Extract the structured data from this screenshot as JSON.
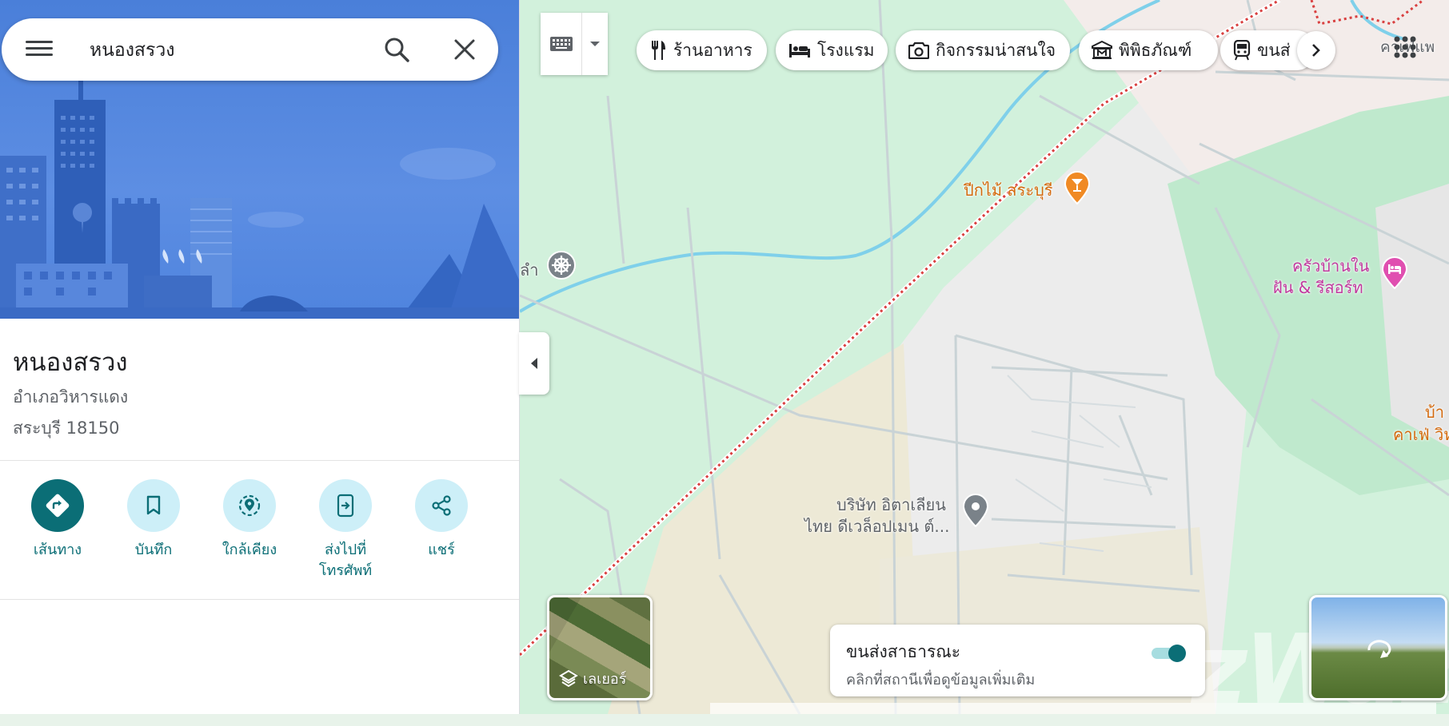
{
  "search": {
    "value": "หนองสรวง"
  },
  "place": {
    "title": "หนองสรวง",
    "address_line1": "อำเภอวิหารแดง",
    "address_line2": "สระบุรี 18150"
  },
  "actions": [
    {
      "label": "เส้นทาง",
      "icon": "directions-icon"
    },
    {
      "label": "บันทึก",
      "icon": "bookmark-icon"
    },
    {
      "label": "ใกล้เคียง",
      "icon": "nearby-icon"
    },
    {
      "label": "ส่งไปที่โทรศัพท์",
      "line1": "ส่งไปที่",
      "line2": "โทรศัพท์",
      "icon": "send-to-phone-icon"
    },
    {
      "label": "แชร์",
      "icon": "share-icon"
    }
  ],
  "chips": [
    {
      "label": "ร้านอาหาร",
      "icon": "restaurant-icon"
    },
    {
      "label": "โรงแรม",
      "icon": "hotel-icon"
    },
    {
      "label": "กิจกรรมน่าสนใจ",
      "icon": "camera-icon"
    },
    {
      "label": "พิพิธภัณฑ์",
      "icon": "museum-icon"
    },
    {
      "label": "ขนส่",
      "icon": "transit-icon"
    }
  ],
  "map_labels": {
    "bar": "ปีกไม้ สระบุรี",
    "resort_line1": "ครัวบ้านใน",
    "resort_line2": "ฝัน & รีสอร์ท",
    "company_line1": "บริษัท อิตาเลียน",
    "company_line2": "ไทย ดีเวล็อปเมน ต์...",
    "left_cut": "ลำ",
    "top_right_cut": "คาเฟ่แพ",
    "right_cut1": "บ้า",
    "right_cut2": "คาเฟ่ วิห"
  },
  "layer": {
    "label": "เลเยอร์"
  },
  "transit": {
    "title": "ขนส่งสาธารณะ",
    "subtitle": "คลิกที่สถานีเพื่อดูข้อมูลเพิ่มเติม",
    "enabled": true
  },
  "watermark": "zWaz",
  "colors": {
    "accent": "#0b6e76",
    "action_bg": "#cdeff8",
    "hero": "#4a7fd9",
    "map_green": "#d2f1dc",
    "railway": "#d94040",
    "river": "#7fd0ea",
    "bar_pin": "#f08a24",
    "hotel_pin": "#e04fb0"
  }
}
